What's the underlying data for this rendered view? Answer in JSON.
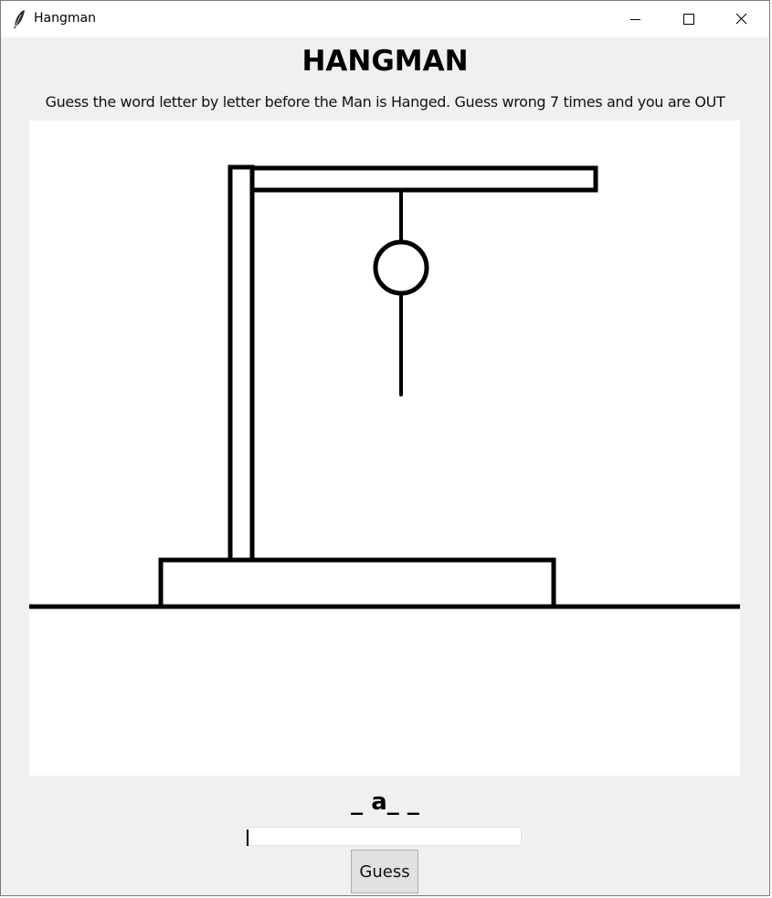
{
  "window": {
    "title": "Hangman",
    "icon": "feather-icon",
    "controls": [
      "minimize-icon",
      "maximize-icon",
      "close-icon"
    ]
  },
  "game": {
    "heading": "HANGMAN",
    "instructions": "Guess the word letter by letter before the Man is Hanged. Guess wrong 7 times and you are OUT",
    "word_display": "_ a_ _",
    "guess_input_value": "",
    "guess_button_label": "Guess",
    "drawing": {
      "parts_shown": [
        "gallows",
        "rope",
        "head",
        "body"
      ]
    }
  },
  "colors": {
    "window_bg": "#f0f0f0",
    "canvas_bg": "#ffffff",
    "stroke": "#000000"
  }
}
